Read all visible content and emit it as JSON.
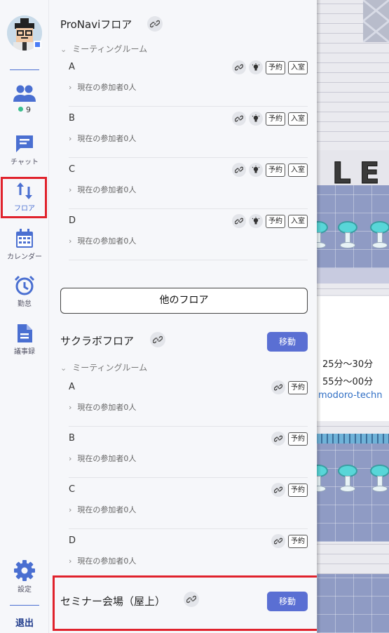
{
  "rail": {
    "online_count": "9",
    "chat_label": "チャット",
    "floor_label": "フロア",
    "calendar_label": "カレンダー",
    "attendance_label": "勤怠",
    "minutes_label": "議事録",
    "settings_label": "設定",
    "exit_label": "退出"
  },
  "floors": [
    {
      "title": "ProNaviフロア",
      "category": "ミーティングルーム",
      "rooms": [
        {
          "name": "A",
          "participants": "現在の参加者0人",
          "reserve": "予約",
          "enter": "入室"
        },
        {
          "name": "B",
          "participants": "現在の参加者0人",
          "reserve": "予約",
          "enter": "入室"
        },
        {
          "name": "C",
          "participants": "現在の参加者0人",
          "reserve": "予約",
          "enter": "入室"
        },
        {
          "name": "D",
          "participants": "現在の参加者0人",
          "reserve": "予約",
          "enter": "入室"
        }
      ]
    },
    {
      "title": "サクラボフロア",
      "move_label": "移動",
      "category": "ミーティングルーム",
      "rooms": [
        {
          "name": "A",
          "participants": "現在の参加者0人",
          "reserve": "予約"
        },
        {
          "name": "B",
          "participants": "現在の参加者0人",
          "reserve": "予約"
        },
        {
          "name": "C",
          "participants": "現在の参加者0人",
          "reserve": "予約"
        },
        {
          "name": "D",
          "participants": "現在の参加者0人",
          "reserve": "予約"
        }
      ]
    }
  ],
  "other_floor_label": "他のフロア",
  "seminar": {
    "title": "セミナー会場（屋上）",
    "move_label": "移動"
  },
  "game": {
    "banner": "LE",
    "board_line1": "25分〜30分",
    "board_line2": "55分〜00分",
    "board_link": "modoro-techn"
  },
  "colors": {
    "accent": "#5a6fd3",
    "highlight": "#e0222c",
    "online": "#3bbf8f"
  }
}
